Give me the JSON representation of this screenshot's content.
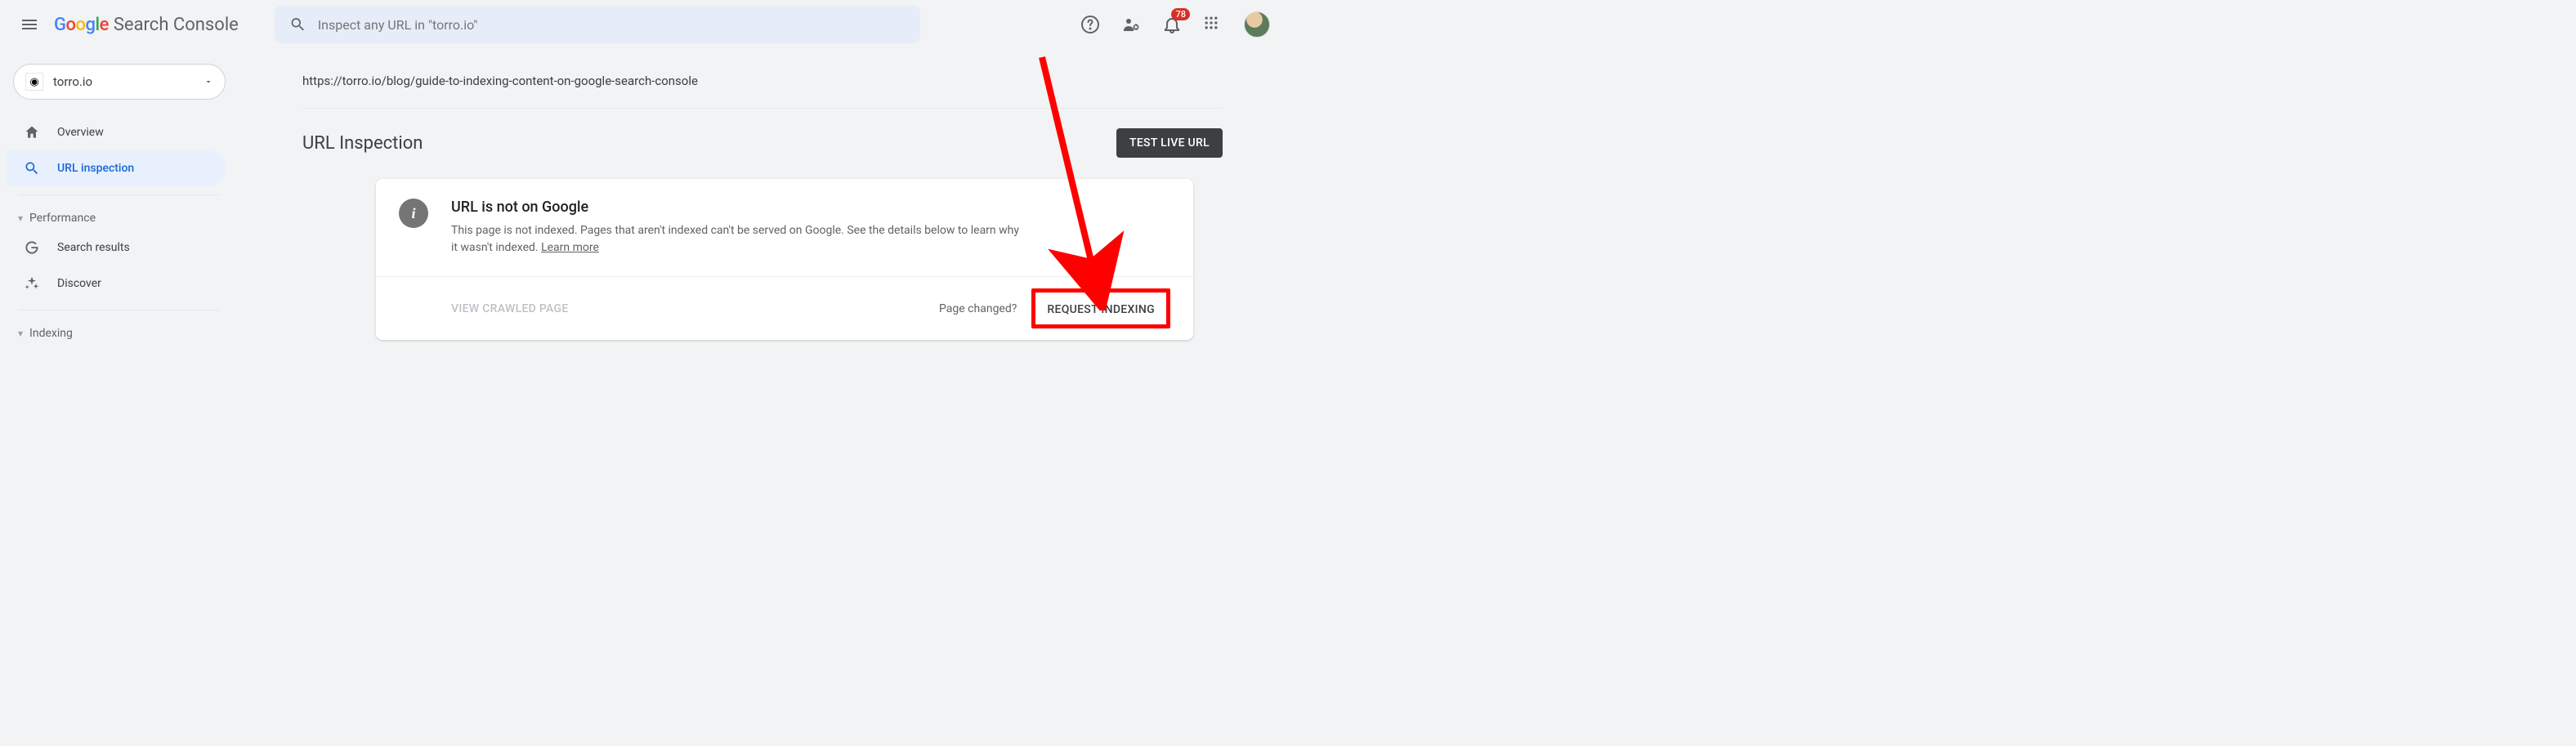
{
  "app": {
    "name_google": "Google",
    "name_sc": "Search Console"
  },
  "search": {
    "placeholder": "Inspect any URL in \"torro.io\""
  },
  "notifications": {
    "count": "78"
  },
  "property": {
    "name": "torro.io"
  },
  "sidebar": {
    "items": [
      {
        "label": "Overview"
      },
      {
        "label": "URL inspection"
      }
    ],
    "sections": [
      {
        "label": "Performance"
      },
      {
        "label": "Indexing"
      }
    ],
    "perf_items": [
      {
        "label": "Search results"
      },
      {
        "label": "Discover"
      }
    ]
  },
  "inspection": {
    "url": "https://torro.io/blog/guide-to-indexing-content-on-google-search-console",
    "title": "URL Inspection",
    "test_button": "TEST LIVE URL",
    "status_title": "URL is not on Google",
    "status_desc_a": "This page is not indexed. Pages that aren't indexed can't be served on Google. See the details below to learn why it wasn't indexed. ",
    "learn_more": "Learn more",
    "view_crawled": "VIEW CRAWLED PAGE",
    "page_changed": "Page changed?",
    "request_indexing": "REQUEST INDEXING"
  }
}
